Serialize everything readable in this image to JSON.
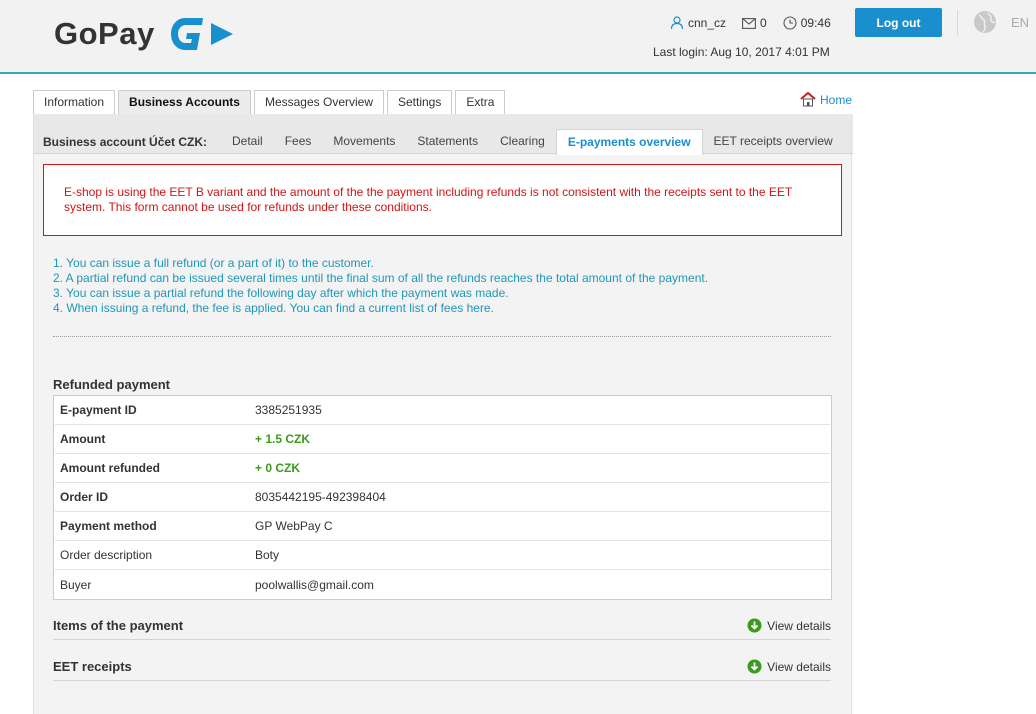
{
  "header": {
    "logo_text": "GoPay",
    "user": "cnn_cz",
    "messages_count": "0",
    "time": "09:46",
    "logout_label": "Log out",
    "last_login": "Last login: Aug 10, 2017 4:01 PM",
    "language": "EN",
    "accent_color": "#1a8fcd"
  },
  "main_tabs": [
    {
      "label": "Information"
    },
    {
      "label": "Business Accounts"
    },
    {
      "label": "Messages Overview"
    },
    {
      "label": "Settings"
    },
    {
      "label": "Extra"
    }
  ],
  "home_link": "Home",
  "sub_nav": {
    "title": "Business account Účet CZK:",
    "tabs": [
      {
        "label": "Detail"
      },
      {
        "label": "Fees"
      },
      {
        "label": "Movements"
      },
      {
        "label": "Statements"
      },
      {
        "label": "Clearing"
      },
      {
        "label": "E-payments overview"
      },
      {
        "label": "EET receipts overview"
      }
    ]
  },
  "error_message": "E-shop is using the EET B variant and the amount of the the payment including refunds is not consistent with the receipts sent to the EET system. This form cannot be used for refunds under these conditions.",
  "info": {
    "items": [
      "1. You can issue a full refund (or a part of it) to the customer.",
      "2. A partial refund can be issued several times until the final sum of all the refunds reaches the total amount of the payment.",
      "3. You can issue a partial refund the following day after which the payment was made.",
      "4. When issuing a refund, the fee is applied. You can find a current list of fees here."
    ]
  },
  "refunded_payment": {
    "title": "Refunded payment",
    "rows": [
      {
        "label": "E-payment ID",
        "value": "3385251935"
      },
      {
        "label": "Amount",
        "value": "+ 1.5 CZK"
      },
      {
        "label": "Amount refunded",
        "value": "+ 0 CZK"
      },
      {
        "label": "Order ID",
        "value": "8035442195-492398404"
      },
      {
        "label": "Payment method",
        "value": "GP WebPay C"
      },
      {
        "label": "Order description",
        "value": "Boty"
      },
      {
        "label": "Buyer",
        "value": "poolwallis@gmail.com"
      }
    ]
  },
  "sections": {
    "items": {
      "title": "Items of the payment",
      "action": "View details"
    },
    "eet": {
      "title": "EET receipts",
      "action": "View details"
    }
  }
}
